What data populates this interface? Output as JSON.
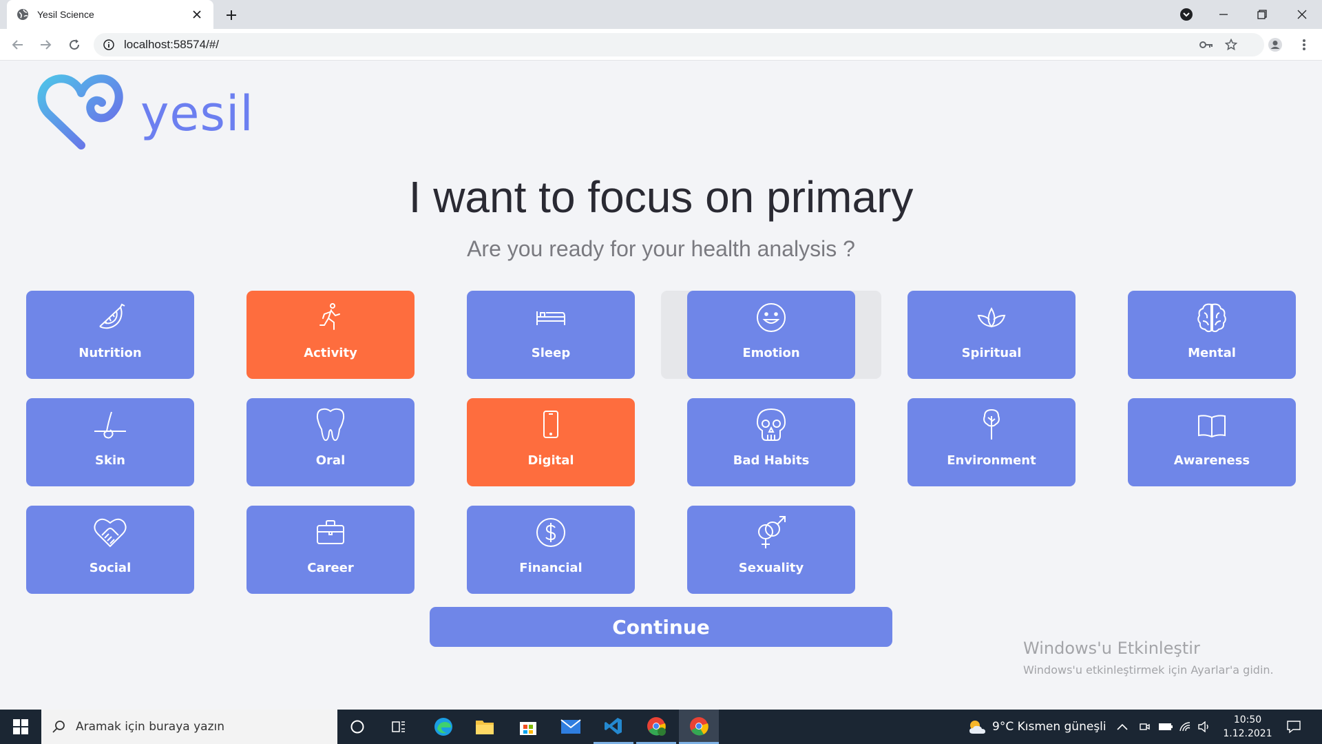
{
  "browser": {
    "tab_title": "Yesil Science",
    "url": "localhost:58574/#/"
  },
  "page": {
    "logo_text": "yesil",
    "headline": "I want to focus on primary",
    "subheadline": "Are you ready for your health analysis ?",
    "categories": [
      {
        "label": "Nutrition",
        "icon": "fruit-slice-icon",
        "selected": false
      },
      {
        "label": "Activity",
        "icon": "running-icon",
        "selected": true
      },
      {
        "label": "Sleep",
        "icon": "bed-icon",
        "selected": false
      },
      {
        "label": "Emotion",
        "icon": "smile-icon",
        "selected": false
      },
      {
        "label": "Spiritual",
        "icon": "lotus-icon",
        "selected": false
      },
      {
        "label": "Mental",
        "icon": "brain-icon",
        "selected": false
      },
      {
        "label": "Skin",
        "icon": "hair-follicle-icon",
        "selected": false
      },
      {
        "label": "Oral",
        "icon": "tooth-icon",
        "selected": false
      },
      {
        "label": "Digital",
        "icon": "phone-icon",
        "selected": true
      },
      {
        "label": "Bad Habits",
        "icon": "skull-icon",
        "selected": false
      },
      {
        "label": "Environment",
        "icon": "tree-icon",
        "selected": false
      },
      {
        "label": "Awareness",
        "icon": "book-icon",
        "selected": false
      },
      {
        "label": "Social",
        "icon": "handshake-heart-icon",
        "selected": false
      },
      {
        "label": "Career",
        "icon": "briefcase-icon",
        "selected": false
      },
      {
        "label": "Financial",
        "icon": "dollar-icon",
        "selected": false
      },
      {
        "label": "Sexuality",
        "icon": "gender-icon",
        "selected": false
      }
    ],
    "continue_label": "Continue"
  },
  "watermark": {
    "line1": "Windows'u Etkinleştir",
    "line2": "Windows'u etkinleştirmek için Ayarlar'a gidin."
  },
  "taskbar": {
    "search_placeholder": "Aramak için buraya yazın",
    "weather": "9°C  Kısmen güneşli",
    "time": "10:50",
    "date": "1.12.2021"
  },
  "colors": {
    "card": "#6f86e8",
    "card_selected": "#fe6d3e",
    "logo": "#6c7ff0"
  }
}
